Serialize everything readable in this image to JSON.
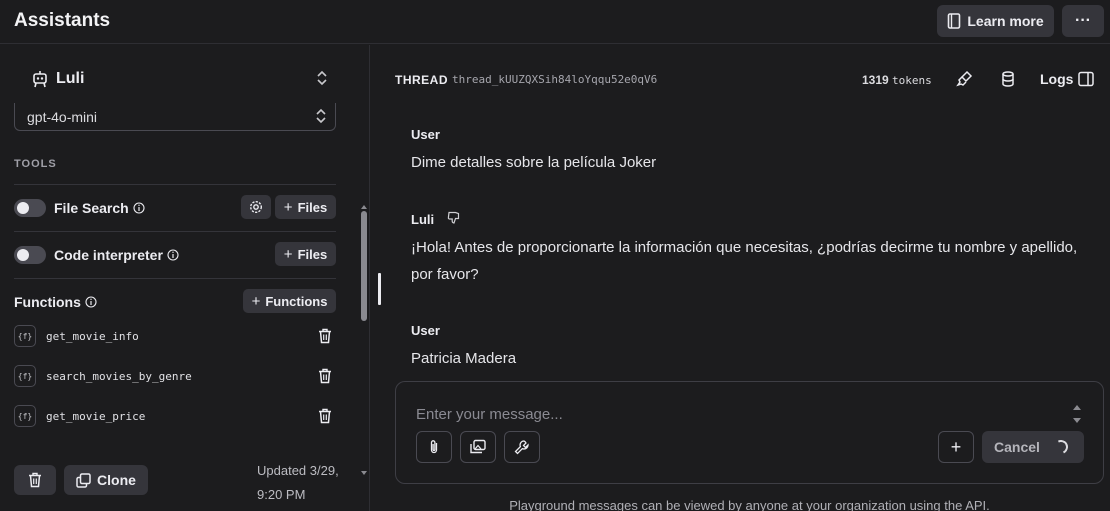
{
  "header": {
    "title": "Assistants",
    "learn_more": "Learn more",
    "more": "···"
  },
  "sidebar": {
    "assistant_name": "Luli",
    "model": "gpt-4o-mini",
    "tools_label": "TOOLS",
    "tools": [
      {
        "name": "File Search",
        "files_label": "Files",
        "enabled": false
      },
      {
        "name": "Code interpreter",
        "files_label": "Files",
        "enabled": false
      }
    ],
    "functions_label": "Functions",
    "add_functions_label": "Functions",
    "functions": [
      {
        "badge": "{f}",
        "name": "get_movie_info"
      },
      {
        "badge": "{f}",
        "name": "search_movies_by_genre"
      },
      {
        "badge": "{f}",
        "name": "get_movie_price"
      }
    ],
    "clone_label": "Clone",
    "updated_line1": "Updated 3/29,",
    "updated_line2": "9:20 PM"
  },
  "thread": {
    "label": "THREAD",
    "id": "thread_kUUZQXSih84loYqqu52e0qV6",
    "token_count": "1319",
    "token_unit": "tokens",
    "logs_label": "Logs",
    "messages": [
      {
        "role": "User",
        "text": "Dime detalles sobre la película Joker"
      },
      {
        "role": "Luli",
        "text": "¡Hola! Antes de proporcionarte la información que necesitas, ¿podrías decirme tu nombre y apellido, por favor?"
      },
      {
        "role": "User",
        "text": "Patricia Madera"
      }
    ]
  },
  "composer": {
    "placeholder": "Enter your message...",
    "cancel_label": "Cancel"
  },
  "footer": {
    "note": "Playground messages can be viewed by anyone at your organization using the API."
  },
  "colors": {
    "background": "#1c1c1e",
    "button_bg": "#35353b",
    "text": "#ececf1"
  }
}
